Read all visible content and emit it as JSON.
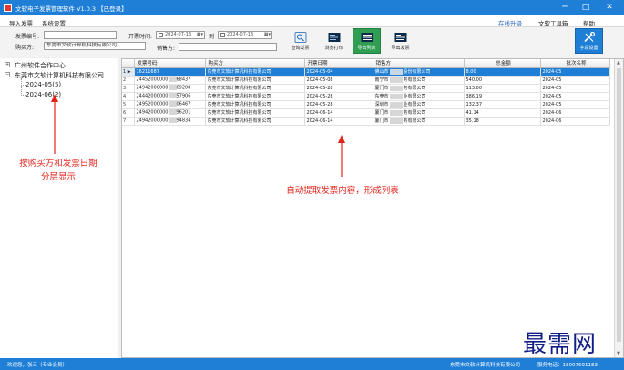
{
  "window": {
    "title": "文软电子发票管理软件 V1.0.3 【已登录】",
    "minimize": "─",
    "maximize": "□",
    "close": "✕"
  },
  "menu": {
    "import": "导入发票",
    "settings": "系统设置",
    "upgrade": "在线升级",
    "toolbox": "文软工具箱",
    "help": "帮助"
  },
  "filters": {
    "invoice_no_label": "发票编号:",
    "invoice_no_value": "",
    "buyer_label": "购买方:",
    "buyer_value": "东莞市文软计算机科技有限公司",
    "date_label": "开票时间:",
    "date_from": "2024-07-13",
    "date_to_label": "到",
    "date_to": "2024-07-13",
    "seller_label": "销售方:",
    "seller_value": ""
  },
  "toolbar_buttons": [
    {
      "label": "查询发票",
      "icon": "search-doc-icon"
    },
    {
      "label": "浏览打印",
      "icon": "print-preview-icon"
    },
    {
      "label": "导出列表",
      "icon": "export-list-icon"
    },
    {
      "label": "导出发票",
      "icon": "export-invoice-icon"
    },
    {
      "label": "字段设置",
      "icon": "tools-icon"
    }
  ],
  "tree": {
    "root1": "广州软件合作中心",
    "root2": "东莞市文软计算机科技有限公司",
    "month1": "2024-05(5)",
    "month2": "2024-06(2)"
  },
  "annotations": {
    "left_line1": "按购买方和发票日期",
    "left_line2": "分层显示",
    "right": "自动提取发票内容，形成列表"
  },
  "table": {
    "columns": [
      "发票号码",
      "购买方",
      "开票日期",
      "销售方",
      "总金额",
      "批次名称"
    ],
    "rows": [
      {
        "num": "1",
        "marker": "▶",
        "invoice": "16211687",
        "buyer": "东莞市文软计算机科技有限公司",
        "date": "2024-05-04",
        "seller": "佛山市",
        "seller_tail": "股份有限公司",
        "amount": "8.00",
        "batch": "2024-05"
      },
      {
        "num": "2",
        "marker": "",
        "invoice": "24452000000",
        "invoice_tail": "68437",
        "buyer": "东莞市文软计算机科技有限公司",
        "date": "2024-05-08",
        "seller": "南宁市",
        "seller_tail": "务有限公司",
        "amount": "540.00",
        "batch": "2024-05"
      },
      {
        "num": "3",
        "marker": "",
        "invoice": "24942000000",
        "invoice_tail": "69208",
        "buyer": "东莞市文软计算机科技有限公司",
        "date": "2024-05-28",
        "seller": "厦门市",
        "seller_tail": "务有限公司",
        "amount": "113.00",
        "batch": "2024-05"
      },
      {
        "num": "4",
        "marker": "",
        "invoice": "24442000000",
        "invoice_tail": "57906",
        "buyer": "东莞市文软计算机科技有限公司",
        "date": "2024-05-28",
        "seller": "东莞市",
        "seller_tail": "业有限公司",
        "amount": "386.19",
        "batch": "2024-05"
      },
      {
        "num": "5",
        "marker": "",
        "invoice": "24952000000",
        "invoice_tail": "06467",
        "buyer": "东莞市文软计算机科技有限公司",
        "date": "2024-05-28",
        "seller": "深圳市",
        "seller_tail": "业有限公司",
        "amount": "132.37",
        "batch": "2024-05"
      },
      {
        "num": "6",
        "marker": "",
        "invoice": "24942000000",
        "invoice_tail": "96201",
        "buyer": "东莞市文软计算机科技有限公司",
        "date": "2024-06-14",
        "seller": "厦门市",
        "seller_tail": "务有限公司",
        "amount": "41.14",
        "batch": "2024-06"
      },
      {
        "num": "7",
        "marker": "",
        "invoice": "24942000000",
        "invoice_tail": "94834",
        "buyer": "东莞市文软计算机科技有限公司",
        "date": "2024-06-14",
        "seller": "厦门市",
        "seller_tail": "务有限公司",
        "amount": "35.18",
        "batch": "2024-06"
      }
    ]
  },
  "watermark": "最需网",
  "status": {
    "welcome": "欢迎您，张三（专业会员）",
    "company": "东莞市文软计算机科技有限公司",
    "service": "服务电话：18007691183"
  },
  "colors": {
    "accent": "#1f7fd6",
    "active_button": "#2f9e53",
    "annotation": "#e2231a",
    "watermark": "#111d86"
  }
}
